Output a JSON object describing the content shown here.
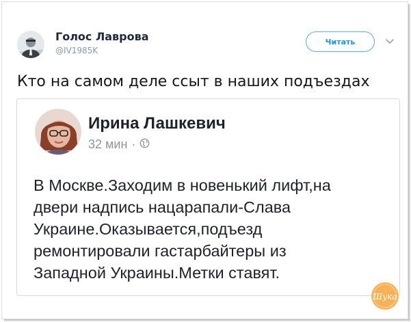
{
  "tweet": {
    "display_name": "Голос Лаврова",
    "handle": "@IV1985K",
    "follow_label": "Читать",
    "text": "Кто на самом деле ссыт в наших подъездах"
  },
  "post": {
    "author": "Ирина Лашкевич",
    "time": "32 мин",
    "separator": "·",
    "body_lines": [
      "В Москве.Заходим в новенький лифт,на",
      "двери надпись нацарапали-Слава",
      "Украине.Оказывается,подъезд",
      "ремонтировали гастарбайтеры из",
      "Западной Украины.Метки ставят."
    ]
  },
  "watermark": {
    "text": "Шука"
  },
  "colors": {
    "twitter_blue": "#1b95e0",
    "secondary_text": "#8899a6",
    "card_border": "#d6d9dc",
    "watermark_orange": "#f3a43a"
  },
  "icons": {
    "follow_dropdown": "chevron-down-icon",
    "privacy": "globe-icon"
  }
}
